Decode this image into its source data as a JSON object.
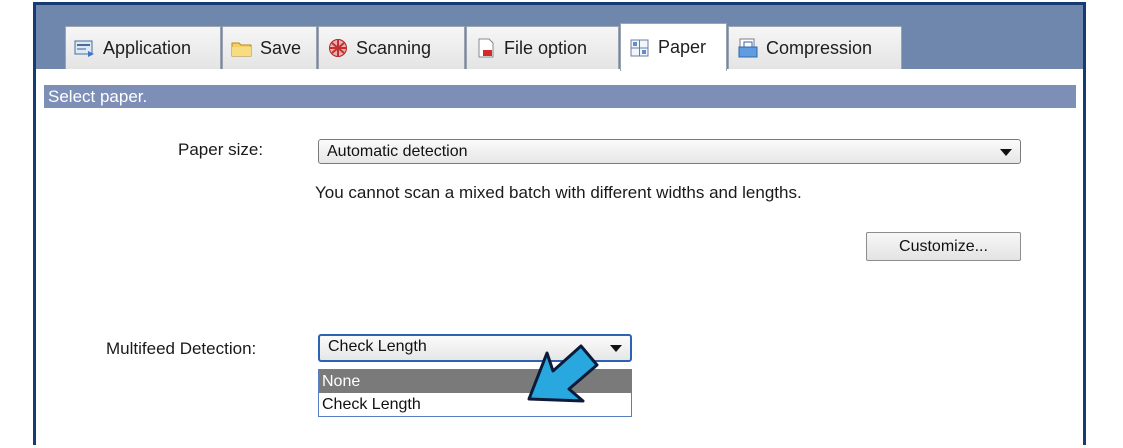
{
  "tabs": [
    {
      "label": "Application",
      "icon": "application-icon",
      "active": false
    },
    {
      "label": "Save",
      "icon": "folder-icon",
      "active": false
    },
    {
      "label": "Scanning",
      "icon": "scanning-icon",
      "active": false
    },
    {
      "label": "File option",
      "icon": "file-option-icon",
      "active": false
    },
    {
      "label": "Paper",
      "icon": "paper-icon",
      "active": true
    },
    {
      "label": "Compression",
      "icon": "compression-icon",
      "active": false
    }
  ],
  "section": {
    "title": "Select paper."
  },
  "paper_size": {
    "label": "Paper size:",
    "value": "Automatic detection",
    "note": "You cannot scan a mixed batch with different widths and lengths.",
    "customize_label": "Customize..."
  },
  "multifeed": {
    "label": "Multifeed Detection:",
    "value": "Check Length",
    "options": [
      "None",
      "Check Length"
    ],
    "highlighted_option": "None"
  },
  "colors": {
    "tabstrip": "#6f87ac",
    "section_bar": "#7d8fb6",
    "frame_border": "#173a75",
    "annotation_arrow": "#29a8e0"
  }
}
